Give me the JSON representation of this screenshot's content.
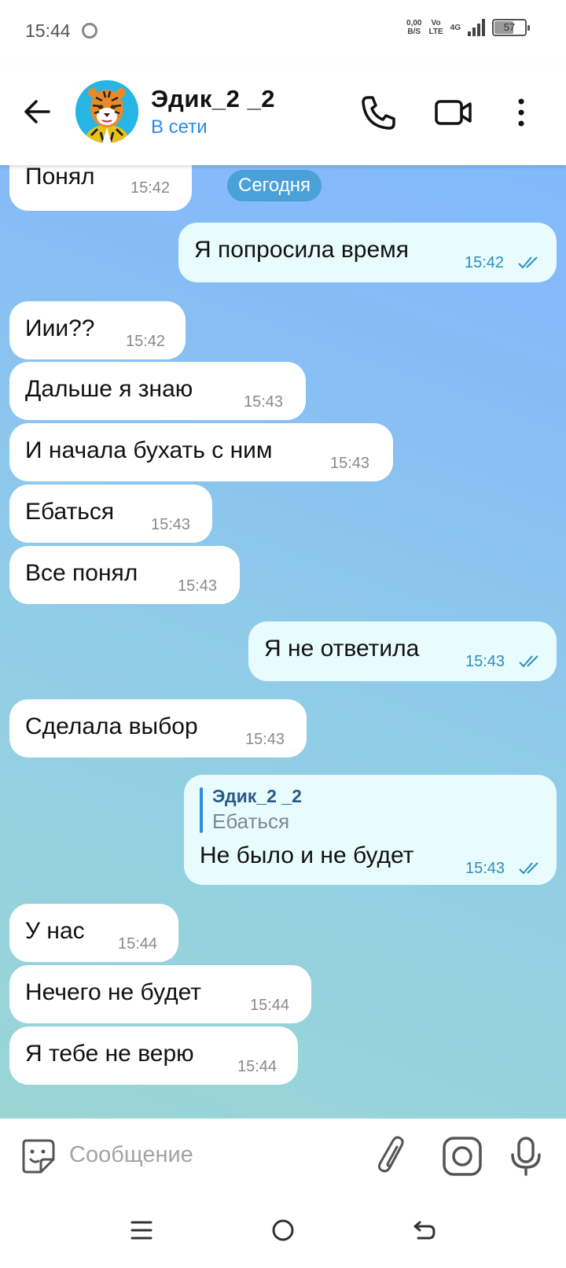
{
  "status_bar": {
    "time": "15:44",
    "net_speed_value": "0,00",
    "net_speed_unit": "B/S",
    "volte_top": "Vo",
    "volte_bottom": "LTE",
    "network": "4G",
    "battery": "57"
  },
  "header": {
    "contact_name": "Эдик_2 _2",
    "contact_status": "В сети",
    "icons": [
      "back-arrow-icon",
      "phone-icon",
      "video-camera-icon",
      "more-vert-icon"
    ]
  },
  "chat": {
    "date_divider": "Сегодня",
    "messages": [
      {
        "direction": "in",
        "text": "Понял",
        "time": "15:42"
      },
      {
        "direction": "out",
        "text": "Я попросила время",
        "time": "15:42",
        "read": true
      },
      {
        "direction": "in",
        "text": "Иии??",
        "time": "15:42"
      },
      {
        "direction": "in",
        "text": "Дальше я знаю",
        "time": "15:43"
      },
      {
        "direction": "in",
        "text": "И начала бухать с ним",
        "time": "15:43"
      },
      {
        "direction": "in",
        "text": "Ебаться",
        "time": "15:43"
      },
      {
        "direction": "in",
        "text": "Все понял",
        "time": "15:43"
      },
      {
        "direction": "out",
        "text": "Я не ответила",
        "time": "15:43",
        "read": true
      },
      {
        "direction": "in",
        "text": "Сделала выбор",
        "time": "15:43"
      },
      {
        "direction": "out",
        "text": "Не было и не будет",
        "time": "15:43",
        "read": true,
        "reply_to": {
          "name": "Эдик_2 _2",
          "text": "Ебаться"
        }
      },
      {
        "direction": "in",
        "text": "У нас",
        "time": "15:44"
      },
      {
        "direction": "in",
        "text": "Нечего не будет",
        "time": "15:44"
      },
      {
        "direction": "in",
        "text": "Я тебе не верю",
        "time": "15:44"
      }
    ]
  },
  "composer": {
    "placeholder": "Сообщение",
    "icons": [
      "sticker-icon",
      "attach-icon",
      "camera-icon",
      "microphone-icon"
    ]
  },
  "navbar": {
    "icons": [
      "menu-icon",
      "home-icon",
      "back-icon"
    ]
  },
  "colors": {
    "accent": "#2b8be6",
    "date_pill": "#4aa1d9",
    "incoming_bubble": "#ffffff",
    "outgoing_bubble": "#e8fbfd",
    "outgoing_time": "#2d8fc0"
  }
}
